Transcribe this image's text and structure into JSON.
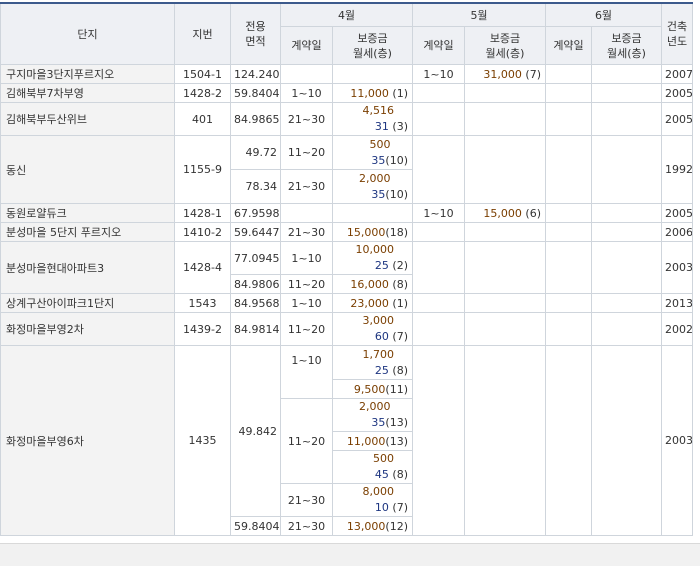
{
  "headers": {
    "complex": "단지",
    "lot": "지번",
    "area_line1": "전용",
    "area_line2": "면적",
    "month4": "4월",
    "month5": "5월",
    "month6": "6월",
    "built_line1": "건축",
    "built_line2": "년도",
    "contract_date": "계약일",
    "deposit": "보증금",
    "rent_floor": "월세(층)"
  },
  "rows": [
    {
      "name": "구지마을3단지푸르지오",
      "lot": "1504-1",
      "area": "124.2404",
      "m5": {
        "date": "1~10",
        "deposit": "31,000",
        "floor": "(7)"
      },
      "year": "2007"
    },
    {
      "name": "김해북부7차부영",
      "lot": "1428-2",
      "area": "59.8404",
      "m4": {
        "date": "1~10",
        "deposit": "11,000",
        "floor": "(1)"
      },
      "year": "2005"
    },
    {
      "name": "김해북부두산위브",
      "lot": "401",
      "area": "84.9865",
      "m4": {
        "date": "21~30",
        "deposit": "4,516",
        "rent": "31",
        "floor": "(3)"
      },
      "year": "2005"
    },
    {
      "name": "동신",
      "lot": "1155-9",
      "year": "1992",
      "sub": [
        {
          "area": "49.72",
          "date": "11~20",
          "deposit": "500",
          "rent": "35",
          "floor": "(10)"
        },
        {
          "area": "78.34",
          "date": "21~30",
          "deposit": "2,000",
          "rent": "35",
          "floor": "(10)"
        }
      ]
    },
    {
      "name": "동원로얄듀크",
      "lot": "1428-1",
      "area": "67.9598",
      "m5": {
        "date": "1~10",
        "deposit": "15,000",
        "floor": "(6)"
      },
      "year": "2005"
    },
    {
      "name": "분성마을 5단지 푸르지오",
      "lot": "1410-2",
      "area": "59.6447",
      "m4": {
        "date": "21~30",
        "deposit": "15,000",
        "floor": "(18)"
      },
      "year": "2006"
    },
    {
      "name": "분성마을현대아파트3",
      "lot": "1428-4",
      "year": "2003",
      "sub": [
        {
          "area": "77.0945",
          "date": "1~10",
          "deposit": "10,000",
          "rent": "25",
          "floor": "(2)"
        },
        {
          "area": "84.9806",
          "date": "11~20",
          "deposit": "16,000",
          "floor": "(8)"
        }
      ]
    },
    {
      "name": "상계구산아이파크1단지",
      "lot": "1543",
      "area": "84.9568",
      "m4": {
        "date": "1~10",
        "deposit": "23,000",
        "floor": "(1)"
      },
      "year": "2013"
    },
    {
      "name": "화정마을부영2차",
      "lot": "1439-2",
      "area": "84.9814",
      "m4": {
        "date": "11~20",
        "deposit": "3,000",
        "rent": "60",
        "floor": "(7)"
      },
      "year": "2002"
    },
    {
      "name": "화정마을부영6차",
      "lot": "1435",
      "year": "2003",
      "area_a": "49.842",
      "area_b": "59.8404",
      "entries": [
        {
          "deposit": "1,700",
          "rent": "25",
          "floor": "(8)"
        },
        {
          "deposit": "9,500",
          "floor": "(11)"
        },
        {
          "deposit": "2,000",
          "rent": "35",
          "floor": "(13)"
        },
        {
          "deposit": "11,000",
          "floor": "(13)"
        },
        {
          "deposit": "500",
          "rent": "45",
          "floor": "(8)"
        },
        {
          "deposit": "8,000",
          "rent": "10",
          "floor": "(7)"
        },
        {
          "deposit": "13,000",
          "floor": "(12)"
        }
      ],
      "dates": [
        "1~10",
        "11~20",
        "21~30",
        "21~30"
      ]
    }
  ]
}
